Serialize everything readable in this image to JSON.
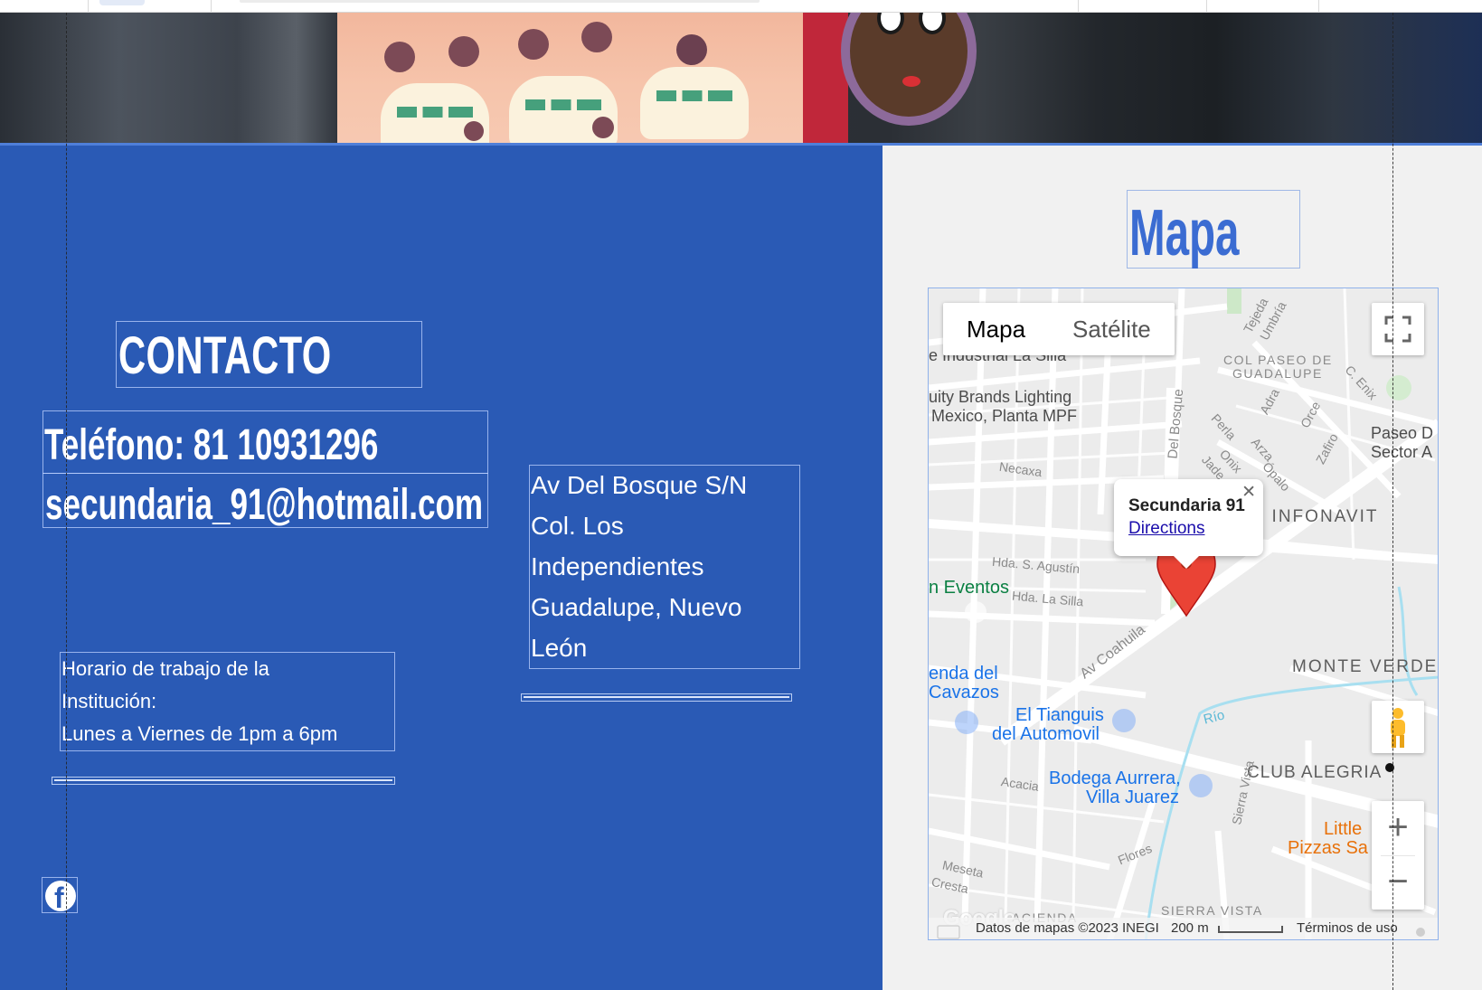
{
  "contact": {
    "title": "CONTACTO",
    "phone": "Teléfono: 81 10931296",
    "email": "secundaria_91@hotmail.com",
    "address_lines": [
      "Av Del Bosque S/N",
      "Col. Los",
      "Independientes",
      "Guadalupe, Nuevo",
      "León"
    ],
    "hours_lines": [
      "Horario de trabajo de la",
      "Institución:",
      "Lunes a Viernes de 1pm a 6pm"
    ],
    "social_icon": "facebook-icon"
  },
  "map_section": {
    "title": "Mapa",
    "map_types": [
      "Mapa",
      "Satélite"
    ],
    "selected_map_type": "Mapa",
    "marker": {
      "name": "Secundaria 91",
      "directions_label": "Directions",
      "close_symbol": "✕"
    },
    "zoom_in_label": "+",
    "zoom_out_label": "−",
    "attribution": {
      "data": "Datos de mapas ©2023 INEGI",
      "scale": "200 m",
      "terms": "Términos de uso"
    },
    "logo": "Google",
    "labels": {
      "industrial": "e Industrial La Silla",
      "brands_1": "uity Brands Lighting",
      "brands_2": "Mexico, Planta MPF",
      "col_paseo_1": "COL PASEO DE",
      "col_paseo_2": "GUADALUPE",
      "paseo_d": "Paseo D",
      "sector_a": "Sector A",
      "infonavit": ". INFONAVIT",
      "eventos": "n Eventos",
      "enda_1": "enda del",
      "enda_2": "Cavazos",
      "tianguis_1": "El Tianguis",
      "tianguis_2": "del Automovil",
      "monte_verde": "MONTE VERDE",
      "club_alegria": "CLUB ALEGRIA",
      "bodega_1": "Bodega Aurrera,",
      "bodega_2": "Villa Juarez",
      "little_1": "Little",
      "little_2": "Pizzas Sa",
      "sierra_vista": "SIERRA VISTA",
      "hacienda": "ACIENDA",
      "av_coahuila": "Av Coahuila",
      "necaxa": "Necaxa",
      "hda_agustin": "Hda. S. Agustín",
      "hda_silla": "Hda. La Silla",
      "acacia": "Acacia",
      "flores": "Flores",
      "del_bosque": "Del Bosque",
      "meseta": "Meseta",
      "cresta": "Cresta",
      "tejeda": "Tejeda",
      "umbria": "Umbría",
      "perla": "Perla",
      "adra": "Adra",
      "orce": "Orce",
      "arza": "Arza",
      "zafiro": "Zafiro",
      "onix": "Onix",
      "opalo": "Ópalo",
      "jade": "Jade",
      "c_enix": "C. Enix",
      "rio": "Río",
      "sierra_vista_st": "Sierra Vista"
    }
  },
  "colors": {
    "contact_panel": "#2a5ab5",
    "map_title": "#3b6cd2",
    "right_panel": "#f1f1f1",
    "map_link": "#1a0dab",
    "marker_red": "#ea4335"
  }
}
